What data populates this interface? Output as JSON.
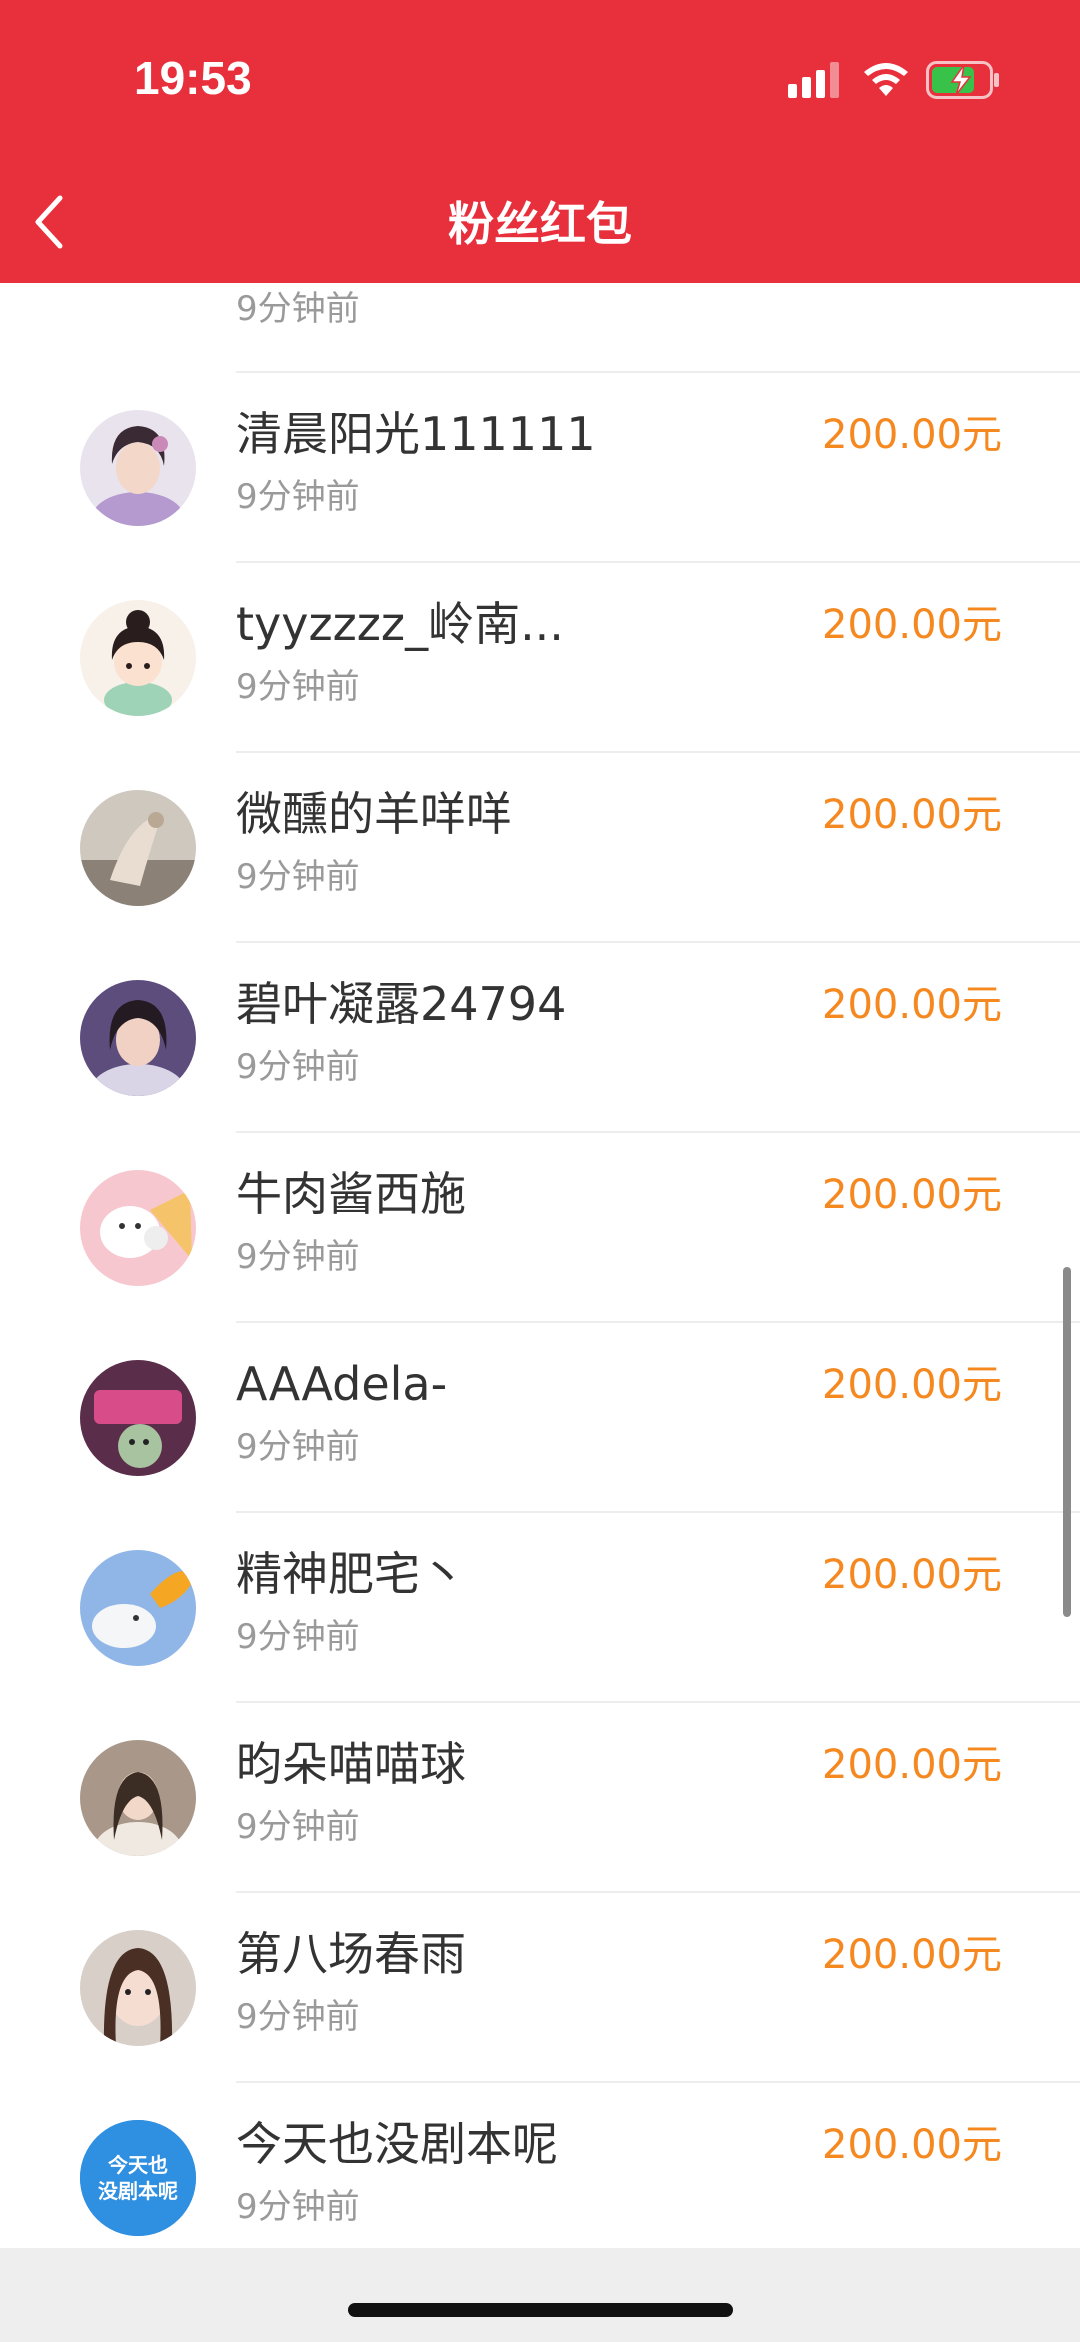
{
  "status_bar": {
    "time": "19:53",
    "icons": [
      "cellular-signal-icon",
      "wifi-icon",
      "battery-charging-icon"
    ]
  },
  "header": {
    "title": "粉丝红包",
    "back_icon": "chevron-left-icon",
    "background_color": "#E8303D"
  },
  "colors": {
    "amount": "#F5881F",
    "name": "#333333",
    "time": "#9a9a9a"
  },
  "list": {
    "items": [
      {
        "name": "",
        "time": "9分钟前",
        "amount": "",
        "avatar": "avatar-man-photo"
      },
      {
        "name": "清晨阳光111111",
        "time": "9分钟前",
        "amount": "200.00元",
        "avatar": "avatar-illustrated-woman"
      },
      {
        "name": "tyyzzzz_岭南...",
        "time": "9分钟前",
        "amount": "200.00元",
        "avatar": "avatar-cartoon-girl"
      },
      {
        "name": "微醺的羊咩咩",
        "time": "9分钟前",
        "amount": "200.00元",
        "avatar": "avatar-photo"
      },
      {
        "name": "碧叶凝露24794",
        "time": "9分钟前",
        "amount": "200.00元",
        "avatar": "avatar-girl-photo"
      },
      {
        "name": "牛肉酱西施",
        "time": "9分钟前",
        "amount": "200.00元",
        "avatar": "avatar-cartoon-dog"
      },
      {
        "name": "AAAdela-",
        "time": "9分钟前",
        "amount": "200.00元",
        "avatar": "avatar-cartoon-cat"
      },
      {
        "name": "精神肥宅丶",
        "time": "9分钟前",
        "amount": "200.00元",
        "avatar": "avatar-cartoon-dragon"
      },
      {
        "name": "昀朵喵喵球",
        "time": "9分钟前",
        "amount": "200.00元",
        "avatar": "avatar-girl-photo"
      },
      {
        "name": "第八场春雨",
        "time": "9分钟前",
        "amount": "200.00元",
        "avatar": "avatar-girl-selfie"
      },
      {
        "name": "今天也没剧本呢",
        "time": "9分钟前",
        "amount": "200.00元",
        "avatar": "avatar-text-badge",
        "avatar_text": [
          "今天也",
          "没剧本呢"
        ]
      }
    ]
  }
}
